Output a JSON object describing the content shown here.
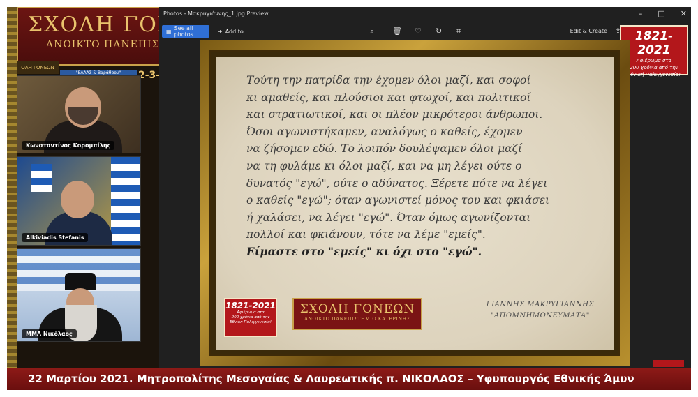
{
  "branding": {
    "title": "ΣΧΟΛΗ ΓΟΝΕ",
    "subtitle": "ΑΝΟΙΚΤΟ ΠΑΝΕΠΙΣΤΗ",
    "mini_info": "ΟΛΗ ΓΟΝΕΩΝ",
    "mini_strip_text": "\"ΕΛΛΑΣ & Βαράθρου\"",
    "partial_date": "2-3-"
  },
  "participants": [
    {
      "name": "Κωνσταντίνος Κορομπίλης"
    },
    {
      "name": "Alkiviadis Stefanis"
    },
    {
      "name": "ΜΜΛ Νικόλαος"
    }
  ],
  "window": {
    "title": "Photos - Μακρυγιάννης_1.jpg Preview",
    "see_all_label": "See all photos",
    "add_to_label": "Add to",
    "edit_create_label": "Edit & Create",
    "controls": [
      "–",
      "□",
      "✕"
    ]
  },
  "badge": {
    "year": "1821-2021",
    "line1": "Αφιέρωμα στα",
    "line2": "200 χρόνια από την",
    "line3": "Εθνική Παλιγγενεσία!"
  },
  "quote": {
    "lines": [
      "Τούτη την πατρίδα την έχομεν όλοι μαζί, και σοφοί",
      "κι αμαθείς, και πλούσιοι και φτωχοί, και πολιτικοί",
      "και στρατιωτικοί, και οι πλέον μικρότεροι άνθρωποι.",
      "Όσοι αγωνιστήκαμεν, αναλόγως ο καθείς, έχομεν",
      "να ζήσομεν εδώ. Το λοιπόν δουλέψαμεν όλοι μαζί",
      "να τη φυλάμε κι όλοι μαζί, και να μη λέγει ούτε ο",
      "δυνατός \"εγώ\", ούτε ο αδύνατος. Ξέρετε πότε να λέγει",
      "ο καθείς \"εγώ\"; όταν αγωνιστεί μόνος του και φκιάσει",
      "ή χαλάσει, να λέγει \"εγώ\". Όταν όμως αγωνίζονται",
      "πολλοί και φκιάνουν, τότε να λέμε \"εμείς\"."
    ],
    "last_line": "Είμαστε στο \"εμείς\" κι όχι στο \"εγώ\"."
  },
  "school_logo": {
    "title": "ΣΧΟΛΗ ΓΟΝΕΩΝ",
    "subtitle": "ΑΝΟΙΚΤΟ ΠΑΝΕΠΙΣΤΗΜΙΟ ΚΑΤΕΡΙΝΗΣ"
  },
  "author": {
    "name": "ΓΙΑΝΝΗΣ ΜΑΚΡΥΓΙΑΝΝΗΣ",
    "work": "\"ΑΠΟΜΝΗΜΟΝΕΥΜΑΤΑ\""
  },
  "ticker": {
    "text": "22 Μαρτίου 2021. Μητροπολίτης Μεσογαίας & Λαυρεωτικής π. ΝΙΚΟΛΑΟΣ – Υφυπουργός Εθνικής Άμυν"
  },
  "colors": {
    "ticker": "#8d1a17",
    "badge": "#b3171b",
    "accent_button": "#2f6fd6",
    "parchment": "#e8e0cd",
    "frame_gold": "#caa23c"
  },
  "icons": [
    "zoom-icon",
    "delete-icon",
    "heart-icon",
    "rotate-icon",
    "crop-icon",
    "share-icon",
    "more-icon"
  ]
}
